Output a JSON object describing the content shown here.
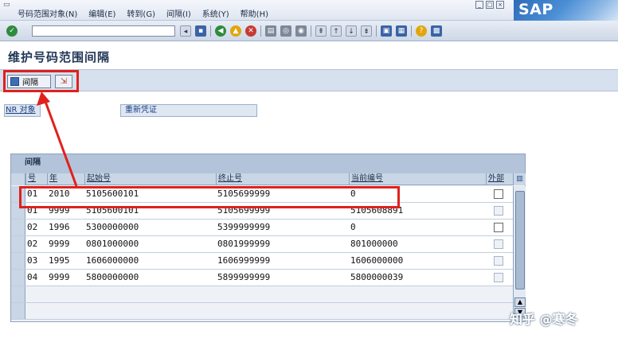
{
  "menubar": {
    "items": [
      "号码范围对象(N)",
      "编辑(E)",
      "转到(G)",
      "间隔(I)",
      "系统(Y)",
      "帮助(H)"
    ],
    "logo_text": "SAP"
  },
  "toolbar": {
    "command_value": "",
    "icons": [
      "ok-icon",
      "save-icon",
      "back-icon",
      "exit-icon",
      "cancel-icon",
      "print-icon",
      "find-icon",
      "find-next-icon",
      "first-page-icon",
      "prev-page-icon",
      "next-page-icon",
      "last-page-icon",
      "new-session-icon",
      "shortcut-icon",
      "help-icon",
      "layout-icon"
    ]
  },
  "title": "维护号码范围间隔",
  "app_toolbar": {
    "interval_button": "间隔"
  },
  "fields": {
    "nr_object_label": "NR 对象",
    "nr_object_value": "重新凭证"
  },
  "table": {
    "title": "间隔",
    "columns": [
      "号",
      "年",
      "起始号",
      "终止号",
      "当前编号",
      "外部"
    ],
    "rows": [
      {
        "no": "01",
        "year": "2010",
        "from": "5105600101",
        "to": "5105699999",
        "current": "0",
        "external": false,
        "external_enabled": true
      },
      {
        "no": "01",
        "year": "9999",
        "from": "5105600101",
        "to": "5105699999",
        "current": "5105608891",
        "external": false,
        "external_enabled": false
      },
      {
        "no": "02",
        "year": "1996",
        "from": "5300000000",
        "to": "5399999999",
        "current": "0",
        "external": false,
        "external_enabled": true
      },
      {
        "no": "02",
        "year": "9999",
        "from": "0801000000",
        "to": "0801999999",
        "current": "801000000",
        "external": false,
        "external_enabled": false
      },
      {
        "no": "03",
        "year": "1995",
        "from": "1606000000",
        "to": "1606999999",
        "current": "1606000000",
        "external": false,
        "external_enabled": false
      },
      {
        "no": "04",
        "year": "9999",
        "from": "5800000000",
        "to": "5899999999",
        "current": "5800000039",
        "external": false,
        "external_enabled": false
      }
    ]
  },
  "watermark": "知乎 @寒冬",
  "colors": {
    "annotation_red": "#e0211c",
    "title_blue": "#1f3556"
  }
}
